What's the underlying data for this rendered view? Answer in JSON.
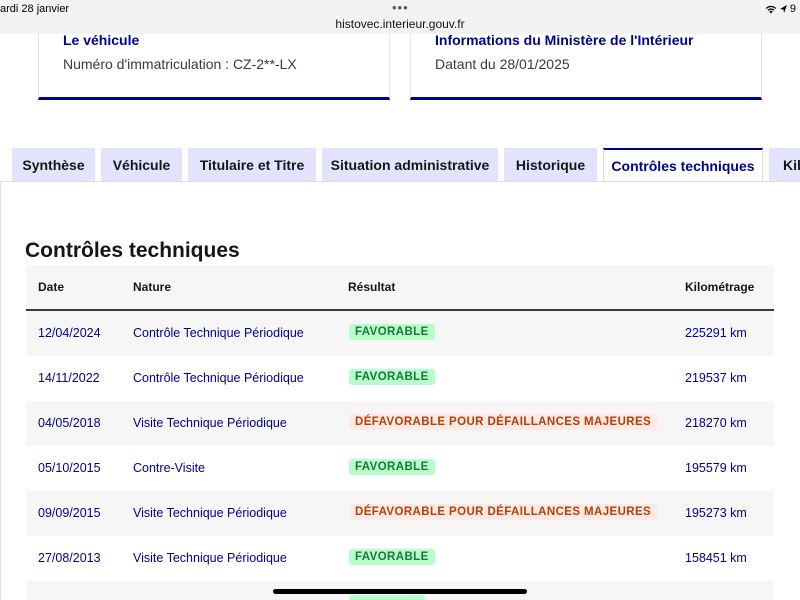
{
  "status_bar": {
    "date": "ardi 28 janvier",
    "more_dots": "•••",
    "url": "histovec.interieur.gouv.fr",
    "battery": "9"
  },
  "cards": [
    {
      "title": "Le véhicule",
      "text": "Numéro d'immatriculation : CZ-2**-LX"
    },
    {
      "title": "Informations du Ministère de l'Intérieur",
      "text": "Datant du 28/01/2025"
    }
  ],
  "tabs": [
    {
      "label": "Synthèse"
    },
    {
      "label": "Véhicule"
    },
    {
      "label": "Titulaire et Titre"
    },
    {
      "label": "Situation administrative"
    },
    {
      "label": "Historique"
    },
    {
      "label": "Contrôles techniques"
    },
    {
      "label": "Kilo"
    }
  ],
  "active_tab": "Contrôles techniques",
  "section_title": "Contrôles techniques",
  "table": {
    "headers": {
      "date": "Date",
      "nature": "Nature",
      "result": "Résultat",
      "km": "Kilométrage"
    },
    "rows": [
      {
        "date": "12/04/2024",
        "nature": "Contrôle Technique Périodique",
        "result": "FAVORABLE",
        "status": "ok",
        "km": "225291 km"
      },
      {
        "date": "14/11/2022",
        "nature": "Contrôle Technique Périodique",
        "result": "FAVORABLE",
        "status": "ok",
        "km": "219537 km"
      },
      {
        "date": "04/05/2018",
        "nature": "Visite Technique Périodique",
        "result": "DÉFAVORABLE POUR DÉFAILLANCES MAJEURES",
        "status": "ko",
        "km": "218270 km"
      },
      {
        "date": "05/10/2015",
        "nature": "Contre-Visite",
        "result": "FAVORABLE",
        "status": "ok",
        "km": "195579 km"
      },
      {
        "date": "09/09/2015",
        "nature": "Visite Technique Périodique",
        "result": "DÉFAVORABLE POUR DÉFAILLANCES MAJEURES",
        "status": "ko",
        "km": "195273 km"
      },
      {
        "date": "27/08/2013",
        "nature": "Visite Technique Périodique",
        "result": "FAVORABLE",
        "status": "ok",
        "km": "158451 km"
      }
    ]
  },
  "colors": {
    "primary": "#000091",
    "tab_inactive": "#e3e3fd",
    "favorable_bg": "#b8fec9",
    "favorable_text": "#18753c",
    "defavorable_bg": "#ffe9e6",
    "defavorable_text": "#b34000"
  }
}
